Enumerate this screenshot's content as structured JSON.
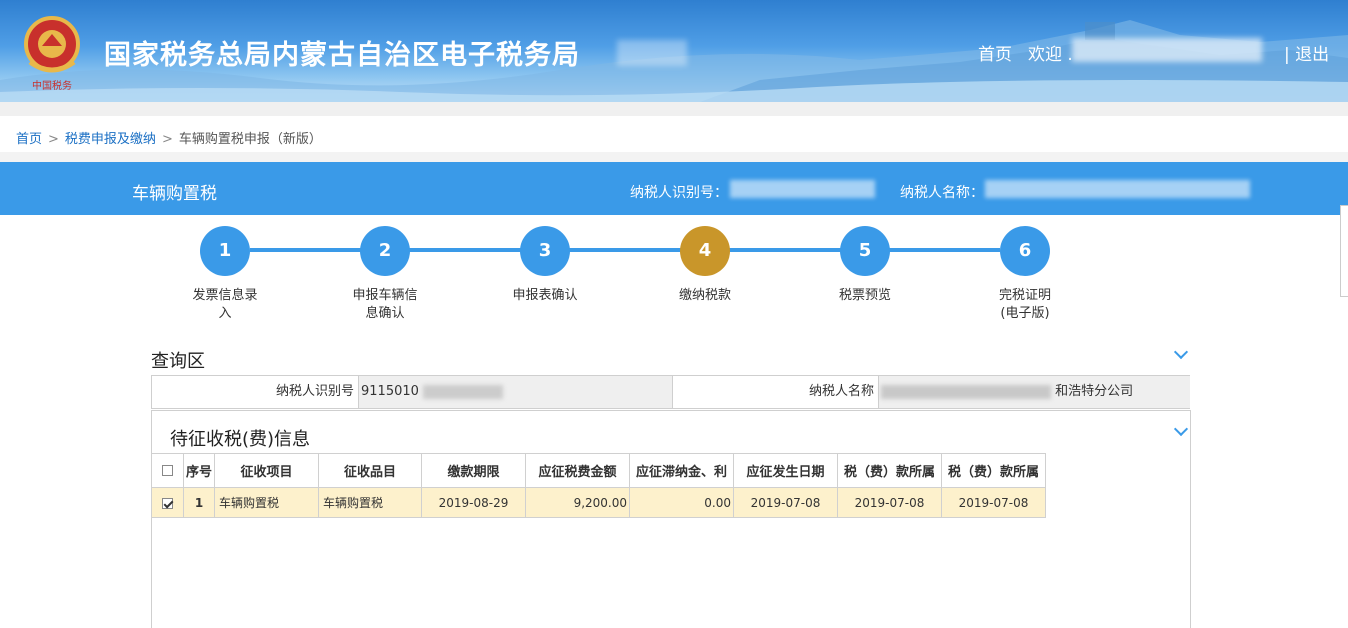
{
  "header": {
    "site_title": "国家税务总局内蒙古自治区电子税务局",
    "home_link": "首页",
    "welcome": "欢迎 .",
    "logout": "| 退出"
  },
  "breadcrumb": {
    "items": [
      "首页",
      "税费申报及缴纳"
    ],
    "current": "车辆购置税申报（新版）"
  },
  "bluebar": {
    "title": "车辆购置税",
    "taxpayer_id_label": "纳税人识别号：",
    "taxpayer_name_label": "纳税人名称："
  },
  "steps": [
    {
      "num": "1",
      "label": "发票信息录入",
      "state": "done"
    },
    {
      "num": "2",
      "label": "申报车辆信息确认",
      "state": "done"
    },
    {
      "num": "3",
      "label": "申报表确认",
      "state": "done"
    },
    {
      "num": "4",
      "label": "缴纳税款",
      "state": "current"
    },
    {
      "num": "5",
      "label": "税票预览",
      "state": "todo"
    },
    {
      "num": "6",
      "label": "完税证明(电子版)",
      "state": "todo"
    }
  ],
  "query": {
    "title": "查询区",
    "taxpayer_id_label": "纳税人识别号",
    "taxpayer_id_value": "9115010",
    "taxpayer_name_label": "纳税人名称",
    "taxpayer_name_value_suffix": "和浩特分公司"
  },
  "pending": {
    "title": "待征收税(费)信息",
    "columns": [
      "序号",
      "征收项目",
      "征收品目",
      "缴款期限",
      "应征税费金额",
      "应征滞纳金、利",
      "应征发生日期",
      "税（费）款所属",
      "税（费）款所属"
    ],
    "rows": [
      {
        "checked": true,
        "seq": "1",
        "item": "车辆购置税",
        "subitem": "车辆购置税",
        "deadline": "2019-08-29",
        "amount": "9,200.00",
        "late_fee": "0.00",
        "occur_date": "2019-07-08",
        "period_start": "2019-07-08",
        "period_end": "2019-07-08"
      }
    ]
  },
  "colors": {
    "accent_blue": "#3a9ae8",
    "current_step": "#c9962a",
    "selected_row": "#fdf1cc"
  }
}
